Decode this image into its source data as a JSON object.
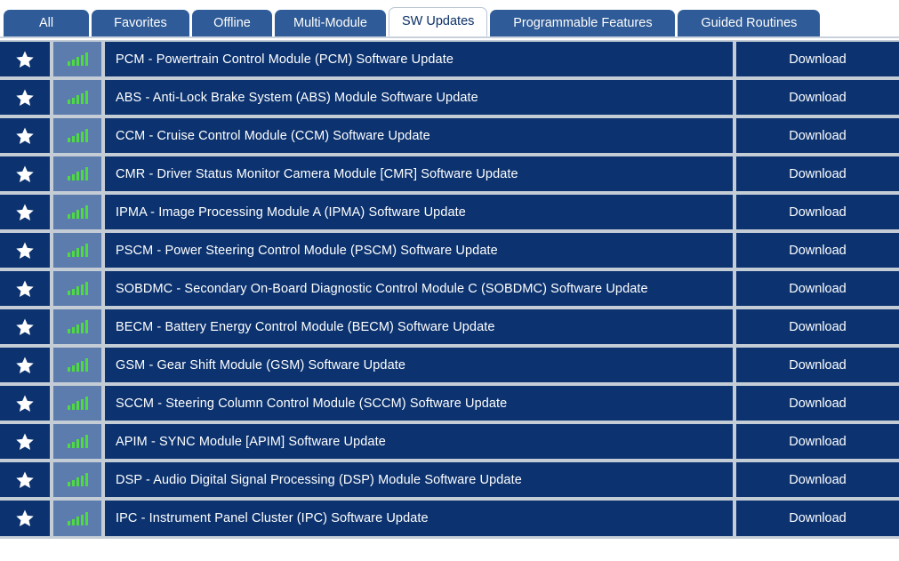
{
  "tabs": [
    {
      "label": "All",
      "active": false,
      "key": "all"
    },
    {
      "label": "Favorites",
      "active": false,
      "key": "favorites"
    },
    {
      "label": "Offline",
      "active": false,
      "key": "offline"
    },
    {
      "label": "Multi-Module",
      "active": false,
      "key": "multi-module"
    },
    {
      "label": "SW Updates",
      "active": true,
      "key": "sw-updates"
    },
    {
      "label": "Programmable Features",
      "active": false,
      "key": "programmable-features"
    },
    {
      "label": "Guided Routines",
      "active": false,
      "key": "guided-routines"
    }
  ],
  "icons": {
    "favorite": "star-icon",
    "signal": "signal-bars-icon"
  },
  "colors": {
    "row_background": "#0c3370",
    "signal_cell_background": "#5b7cad",
    "grid_gap": "#c4ccd6",
    "tab_inactive": "#2f5c99",
    "tab_active_background": "#ffffff",
    "tab_active_text": "#13386d",
    "signal_bars": "#4ddb3f",
    "text": "#ffffff"
  },
  "action_label": "Download",
  "rows": [
    {
      "title": "PCM - Powertrain Control Module (PCM) Software Update",
      "action": "Download",
      "favorite": true,
      "signal": 5
    },
    {
      "title": "ABS - Anti-Lock Brake System (ABS) Module Software Update",
      "action": "Download",
      "favorite": true,
      "signal": 5
    },
    {
      "title": "CCM - Cruise Control Module (CCM) Software Update",
      "action": "Download",
      "favorite": true,
      "signal": 5
    },
    {
      "title": "CMR - Driver Status Monitor Camera Module [CMR] Software Update",
      "action": "Download",
      "favorite": true,
      "signal": 5
    },
    {
      "title": "IPMA - Image Processing Module A (IPMA) Software Update",
      "action": "Download",
      "favorite": true,
      "signal": 5
    },
    {
      "title": "PSCM - Power Steering Control Module (PSCM) Software Update",
      "action": "Download",
      "favorite": true,
      "signal": 5
    },
    {
      "title": "SOBDMC - Secondary On-Board Diagnostic Control Module C (SOBDMC) Software Update",
      "action": "Download",
      "favorite": true,
      "signal": 5
    },
    {
      "title": "BECM - Battery Energy Control Module (BECM) Software Update",
      "action": "Download",
      "favorite": true,
      "signal": 5
    },
    {
      "title": "GSM - Gear Shift Module (GSM) Software Update",
      "action": "Download",
      "favorite": true,
      "signal": 5
    },
    {
      "title": "SCCM - Steering Column Control Module (SCCM) Software Update",
      "action": "Download",
      "favorite": true,
      "signal": 5
    },
    {
      "title": "APIM - SYNC Module [APIM] Software Update",
      "action": "Download",
      "favorite": true,
      "signal": 5
    },
    {
      "title": "DSP - Audio Digital Signal Processing (DSP) Module Software Update",
      "action": "Download",
      "favorite": true,
      "signal": 5
    },
    {
      "title": "IPC - Instrument Panel Cluster (IPC) Software Update",
      "action": "Download",
      "favorite": true,
      "signal": 5
    }
  ]
}
